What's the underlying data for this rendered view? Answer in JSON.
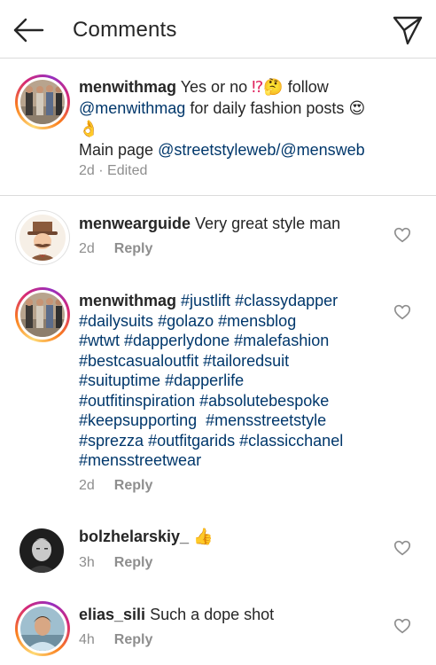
{
  "header": {
    "title": "Comments"
  },
  "caption": {
    "username": "menwithmag",
    "text_before": " Yes or no ",
    "emoji_1": "⁉",
    "emoji_2": "🤔",
    "text_follow": " follow",
    "mention_1": "@menwithmag",
    "text_daily": " for daily fashion posts ",
    "emoji_3": "😍",
    "emoji_4": "👌",
    "main_page_text": "Main page ",
    "mention_2": "@streetstyleweb/@mensweb",
    "time": "2d",
    "edited": "Edited"
  },
  "comments": [
    {
      "username": "menwearguide",
      "text": " Very great style man",
      "time": "2d",
      "reply_label": "Reply"
    },
    {
      "username": "menwithmag",
      "hashtags": [
        "#justlift",
        "#classydapper",
        "#dailysuits",
        "#golazo",
        "#mensblog",
        "#wtwt",
        "#dapperlydone",
        "#malefashion",
        "#bestcasualoutfit",
        "#tailoredsuit",
        "#suituptime",
        "#dapperlife",
        "#outfitinspiration",
        "#absolutebespoke",
        "#keepsupporting",
        "#mensstreetstyle",
        "#sprezza",
        "#outfitgarids",
        "#classicchanel",
        "#mensstreetwear"
      ],
      "time": "2d",
      "reply_label": "Reply"
    },
    {
      "username": "bolzhelarskiy_",
      "emoji": "👍",
      "time": "3h",
      "reply_label": "Reply"
    },
    {
      "username": "elias_sili",
      "text": " Such a dope shot",
      "time": "4h",
      "reply_label": "Reply"
    }
  ],
  "colors": {
    "link": "#00376b",
    "meta": "#8e8e8e",
    "divider": "#dbdbdb"
  },
  "icons": {
    "back": "arrow-left-icon",
    "direct": "paper-plane-icon",
    "like": "heart-outline-icon"
  }
}
